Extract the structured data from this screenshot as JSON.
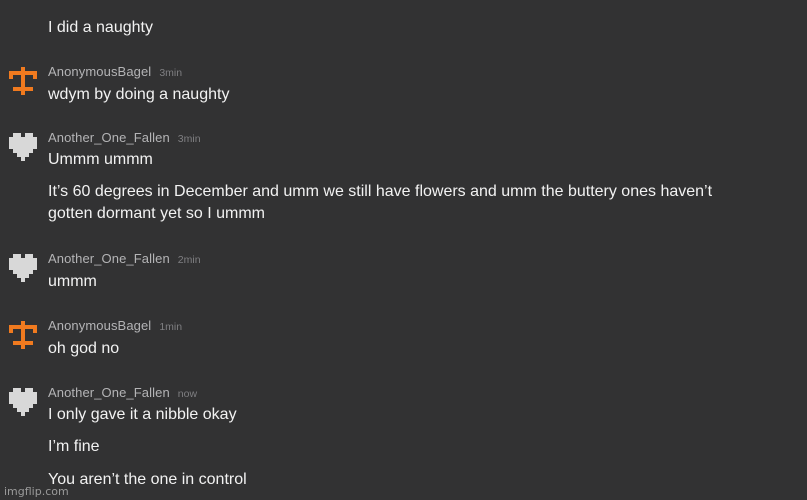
{
  "colors": {
    "background": "#323233",
    "text": "#f2f2f2",
    "username": "#b4b4b6",
    "timestamp": "#7f7f82",
    "bagel_avatar": "#f07a1f",
    "heart_avatar": "#d8d8d8"
  },
  "chat": {
    "top_message": "I did a naughty",
    "groups": [
      {
        "user": "AnonymousBagel",
        "time": "3min",
        "avatar_icon": "bagel-avatar-icon",
        "messages": [
          "wdym by doing a naughty"
        ]
      },
      {
        "user": "Another_One_Fallen",
        "time": "3min",
        "avatar_icon": "heart-avatar-icon",
        "messages": [
          "Ummm ummm",
          "It’s 60 degrees in December and umm we still have flowers and umm the buttery ones haven’t gotten dormant yet so I ummm"
        ]
      },
      {
        "user": "Another_One_Fallen",
        "time": "2min",
        "avatar_icon": "heart-avatar-icon",
        "messages": [
          "ummm"
        ]
      },
      {
        "user": "AnonymousBagel",
        "time": "1min",
        "avatar_icon": "bagel-avatar-icon",
        "messages": [
          "oh god no"
        ]
      },
      {
        "user": "Another_One_Fallen",
        "time": "now",
        "avatar_icon": "heart-avatar-icon",
        "messages": [
          "I only gave it a nibble okay",
          "I’m fine",
          "You aren’t the one in control"
        ]
      }
    ]
  },
  "watermark": "imgflip.com"
}
